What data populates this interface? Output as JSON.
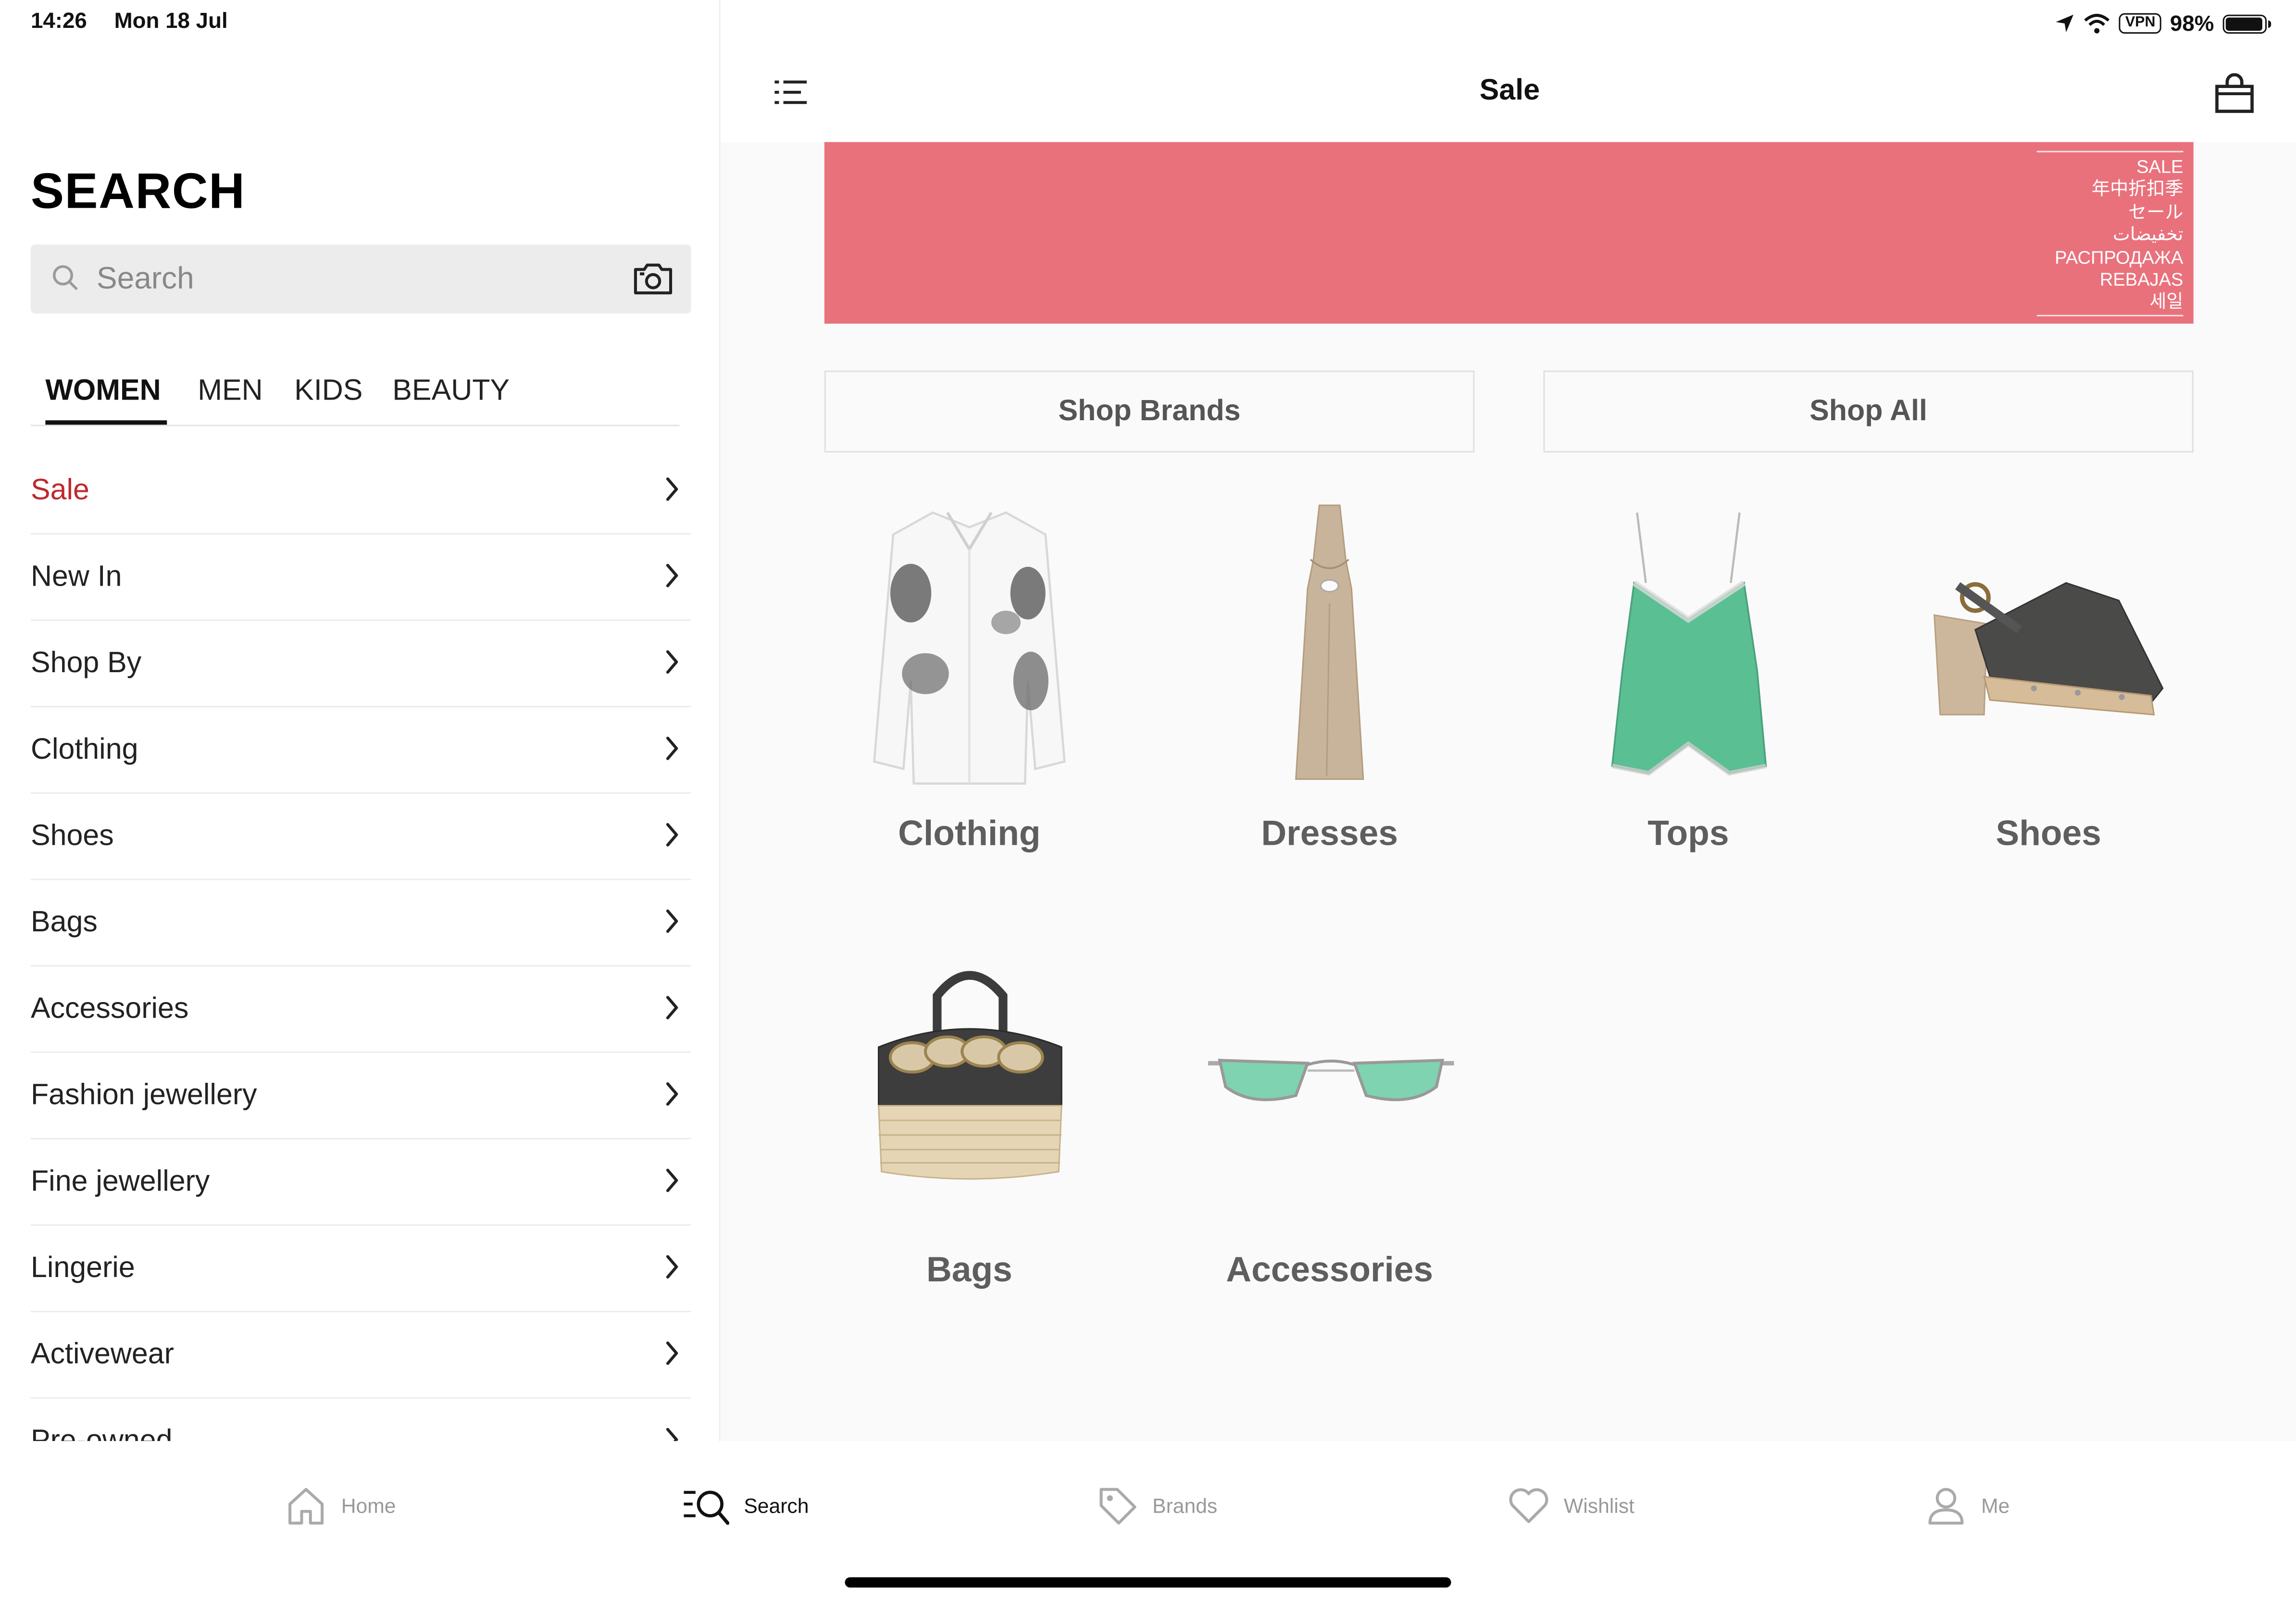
{
  "status_bar": {
    "time": "14:26",
    "date": "Mon 18 Jul",
    "vpn": "VPN",
    "battery": "98%",
    "battery_level": 0.98
  },
  "search_panel": {
    "title": "SEARCH",
    "search_placeholder": "Search",
    "gender_tabs": [
      "WOMEN",
      "MEN",
      "KIDS",
      "BEAUTY"
    ],
    "active_gender": "WOMEN",
    "categories": [
      "Sale",
      "New In",
      "Shop By",
      "Clothing",
      "Shoes",
      "Bags",
      "Accessories",
      "Fashion jewellery",
      "Fine jewellery",
      "Lingerie",
      "Activewear",
      "Pre-owned"
    ]
  },
  "sale_panel": {
    "nav_title": "Sale",
    "banner_lines": [
      "SALE",
      "年中折扣季",
      "セール",
      "تخفيضات",
      "РАСПРОДАЖА",
      "REBAJAS",
      "세일"
    ],
    "shop_brands_label": "Shop Brands",
    "shop_all_label": "Shop All",
    "tiles": [
      {
        "label": "Clothing",
        "icon": "white-lace-shirt-image"
      },
      {
        "label": "Dresses",
        "icon": "beige-cutout-dress-image"
      },
      {
        "label": "Tops",
        "icon": "green-lace-camisole-image"
      },
      {
        "label": "Shoes",
        "icon": "clog-sandal-image"
      },
      {
        "label": "Bags",
        "icon": "chain-wicker-bag-image"
      },
      {
        "label": "Accessories",
        "icon": "green-sunglasses-image"
      }
    ]
  },
  "tab_bar": {
    "tabs": [
      {
        "label": "Home",
        "icon": "home-icon"
      },
      {
        "label": "Search",
        "icon": "search-list-icon"
      },
      {
        "label": "Brands",
        "icon": "tag-icon"
      },
      {
        "label": "Wishlist",
        "icon": "heart-icon"
      },
      {
        "label": "Me",
        "icon": "person-icon"
      }
    ],
    "active": "Search"
  },
  "colors": {
    "sale_red": "#c0282d",
    "banner_pink": "#e9717c",
    "text_dark": "#222222",
    "muted": "#999999"
  }
}
